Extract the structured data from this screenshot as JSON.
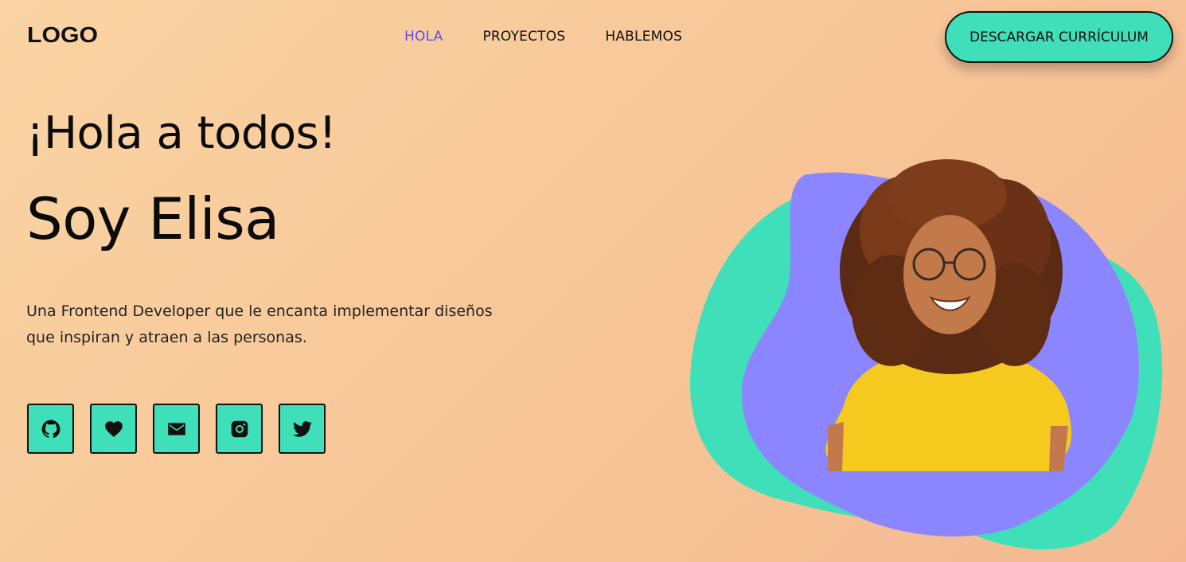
{
  "header": {
    "logo": "LOGO",
    "nav": [
      {
        "label": "HOLA",
        "active": true
      },
      {
        "label": "PROYECTOS",
        "active": false
      },
      {
        "label": "HABLEMOS",
        "active": false
      }
    ],
    "cta_label": "DESCARGAR CURRÍCULUM"
  },
  "hero": {
    "greeting": "¡Hola a todos!",
    "name": "Soy Elisa",
    "description": "Una Frontend Developer que le encanta implementar diseños que inspiran y atraen a las personas."
  },
  "socials": [
    {
      "icon": "github-icon"
    },
    {
      "icon": "heart-icon"
    },
    {
      "icon": "mail-icon"
    },
    {
      "icon": "instagram-icon"
    },
    {
      "icon": "twitter-icon"
    }
  ],
  "colors": {
    "accent": "#3fe0b9",
    "nav_active": "#5b4cf0",
    "blob_purple": "#8b86ff",
    "shirt": "#f5c91e"
  }
}
